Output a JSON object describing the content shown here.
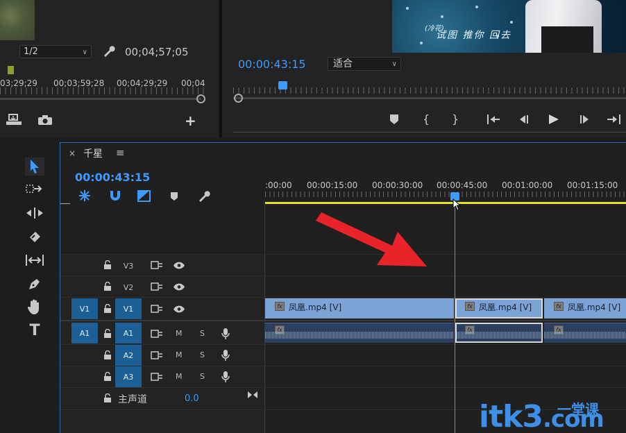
{
  "source_monitor": {
    "zoom": "1/2",
    "timecode": "00;04;57;05",
    "ruler_labels": [
      "03;29;29",
      "00;03;59;28",
      "00;04;29;29",
      "00;04"
    ]
  },
  "program_monitor": {
    "timecode": "00:00:43:15",
    "fit": "适合",
    "subtitle_small": "(冷花)",
    "subtitle": "试图 推你 回去"
  },
  "timeline": {
    "sequence_name": "千星",
    "timecode": "00:00:43:15",
    "ruler_labels": [
      ":00:00",
      "00:00:15:00",
      "00:00:30:00",
      "00:00:45:00",
      "00:01:00:00",
      "00:01:15:00"
    ],
    "tracks": {
      "v3": "V3",
      "v2": "V2",
      "v1_src": "V1",
      "v1": "V1",
      "a1_src": "A1",
      "a1": "A1",
      "a2": "A2",
      "a3": "A3",
      "mute": "M",
      "solo": "S"
    },
    "master": {
      "label": "主声道",
      "value": "0.0"
    },
    "clips": [
      {
        "label": "凤凰.mp4 [V]"
      },
      {
        "label": "凤凰.mp4 [V]"
      },
      {
        "label": "凤凰.mp4 [V]"
      }
    ],
    "fx_badge": "fx"
  },
  "watermark": {
    "text": "itk3",
    "cn": "一堂课",
    "suffix": ".com"
  },
  "colors": {
    "accent": "#3d9bff",
    "workarea": "#e4e11a",
    "track_badge": "#1d5f94",
    "arrow": "#e8242a"
  }
}
